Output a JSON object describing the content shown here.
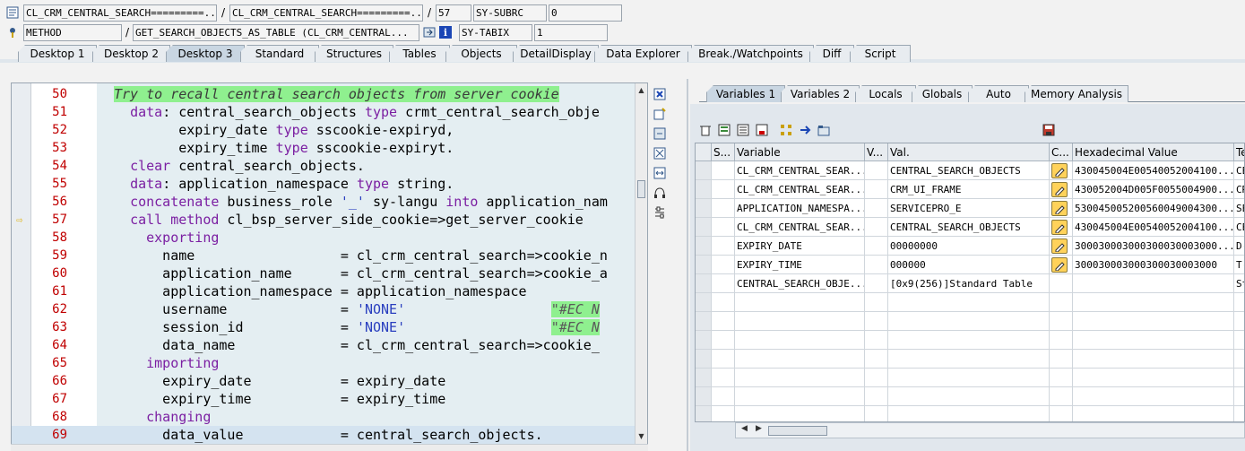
{
  "header": {
    "row1": {
      "program": "CL_CRM_CENTRAL_SEARCH=========...",
      "include": "CL_CRM_CENTRAL_SEARCH=========...",
      "line": "57",
      "sysfield_name": "SY-SUBRC",
      "sysfield_value": "0"
    },
    "row2": {
      "event_type": "METHOD",
      "event": "GET_SEARCH_OBJECTS_AS_TABLE (CL_CRM_CENTRAL...",
      "sysfield_name": "SY-TABIX",
      "sysfield_value": "1"
    },
    "slash": "/"
  },
  "desktop_tabs": [
    "Desktop 1",
    "Desktop 2",
    "Desktop 3",
    "Standard",
    "Structures",
    "Tables",
    "Objects",
    "DetailDisplay",
    "Data Explorer",
    "Break./Watchpoints",
    "Diff",
    "Script"
  ],
  "active_desktop_tab": "Desktop 3",
  "source": {
    "lines": [
      {
        "n": "50",
        "html": "<span class=\"cmt\">Try to recall central search objects from server cookie</span>"
      },
      {
        "n": "51",
        "html": "  <span class=\"kw\">data</span>: central_search_objects <span class=\"kw\">type</span> crmt_central_search_obje"
      },
      {
        "n": "52",
        "html": "        expiry_date <span class=\"kw\">type</span> sscookie-expiryd,"
      },
      {
        "n": "53",
        "html": "        expiry_time <span class=\"kw\">type</span> sscookie-expiryt."
      },
      {
        "n": "54",
        "html": "  <span class=\"kw\">clear</span> central_search_objects."
      },
      {
        "n": "55",
        "html": "  <span class=\"kw\">data</span>: application_namespace <span class=\"kw\">type</span> string."
      },
      {
        "n": "56",
        "html": "  <span class=\"kw\">concatenate</span> business_role <span class=\"str\">'_'</span> sy-langu <span class=\"kw\">into</span> application_nam"
      },
      {
        "n": "57",
        "html": "  <span class=\"kw\">call method</span> cl_bsp_server_side_cookie=&gt;get_server_cookie"
      },
      {
        "n": "58",
        "html": "    <span class=\"kw\">exporting</span>"
      },
      {
        "n": "59",
        "html": "      name                  = cl_crm_central_search=&gt;cookie_n"
      },
      {
        "n": "60",
        "html": "      application_name      = cl_crm_central_search=&gt;cookie_a"
      },
      {
        "n": "61",
        "html": "      application_namespace = application_namespace"
      },
      {
        "n": "62",
        "html": "      username              = <span class=\"str\">'NONE'</span>                  <span class=\"pcm\">\"#EC N</span>"
      },
      {
        "n": "63",
        "html": "      session_id            = <span class=\"str\">'NONE'</span>                  <span class=\"pcm\">\"#EC N</span>"
      },
      {
        "n": "64",
        "html": "      data_name             = cl_crm_central_search=&gt;cookie_"
      },
      {
        "n": "65",
        "html": "    <span class=\"kw\">importing</span>"
      },
      {
        "n": "66",
        "html": "      expiry_date           = expiry_date"
      },
      {
        "n": "67",
        "html": "      expiry_time           = expiry_time"
      },
      {
        "n": "68",
        "html": "    <span class=\"kw\">changing</span>"
      },
      {
        "n": "69",
        "html": "      data_value            = central_search_objects."
      }
    ],
    "current_line": "57",
    "cursor_line": "69"
  },
  "var_tabs": [
    "Variables 1",
    "Variables 2",
    "Locals",
    "Globals",
    "Auto",
    "Memory Analysis"
  ],
  "active_var_tab": "Variables 1",
  "grid": {
    "headers": [
      "S...",
      "Variable",
      "V...",
      "Val.",
      "C...",
      "Hexadecimal Value",
      "Te"
    ],
    "rows": [
      {
        "variable": "CL_CRM_CENTRAL_SEAR...",
        "value": "CENTRAL_SEARCH_OBJECTS",
        "edit": true,
        "hex": "430045004E00540052004100...",
        "te": "CE"
      },
      {
        "variable": "CL_CRM_CENTRAL_SEAR...",
        "value": "CRM_UI_FRAME",
        "edit": true,
        "hex": "430052004D005F0055004900...",
        "te": "CR"
      },
      {
        "variable": "APPLICATION_NAMESPA...",
        "value": "SERVICEPRO_E",
        "edit": true,
        "hex": "530045005200560049004300...",
        "te": "SE"
      },
      {
        "variable": "CL_CRM_CENTRAL_SEAR...",
        "value": "CENTRAL_SEARCH_OBJECTS",
        "edit": true,
        "hex": "430045004E00540052004100...",
        "te": "CE"
      },
      {
        "variable": "EXPIRY_DATE",
        "value": "00000000",
        "edit": true,
        "hex": "300030003000300030003000...",
        "te": "D("
      },
      {
        "variable": "EXPIRY_TIME",
        "value": "000000",
        "edit": true,
        "hex": "300030003000300030003000",
        "te": "T("
      },
      {
        "variable": "CENTRAL_SEARCH_OBJE...",
        "value": "[0x9(256)]Standard Table",
        "edit": false,
        "hex": "",
        "te": "St"
      }
    ]
  },
  "icons": {
    "header1": "source-code-icon",
    "header2": "method-icon",
    "navigate": "navigate-icon",
    "info": "info-icon",
    "save": "save-icon"
  },
  "colors": {
    "accent": "#c9d6e2",
    "comment_bg": "#8ff08f",
    "line_number": "#c00000",
    "keyword": "#7b1fa2"
  }
}
